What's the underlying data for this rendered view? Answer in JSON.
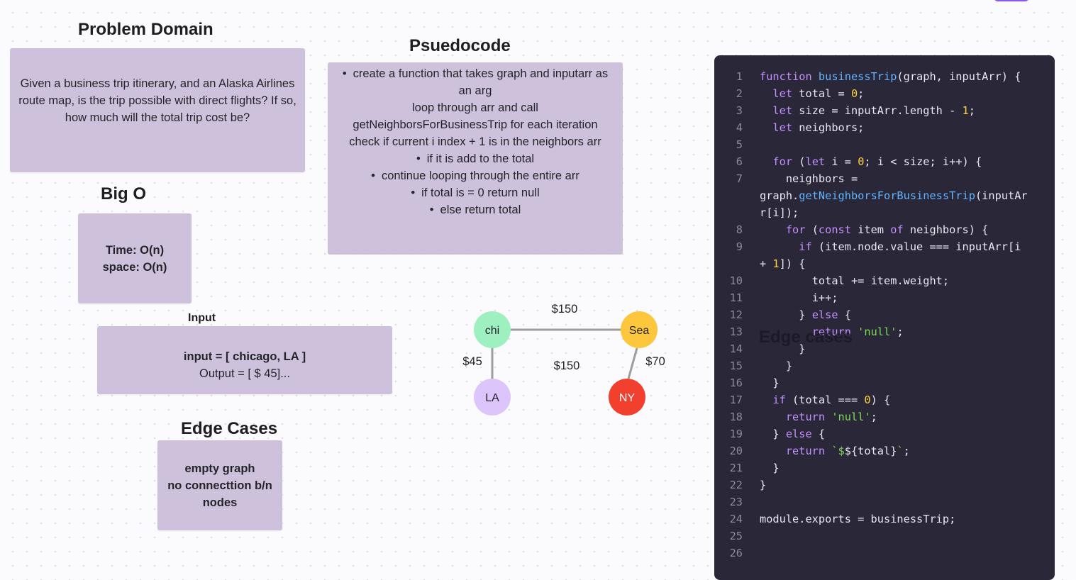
{
  "problem_domain": {
    "heading": "Problem Domain",
    "text": "Given a business trip itinerary, and an Alaska Airlines route map, is the trip possible with direct flights? If so, how much will the total trip cost be?"
  },
  "big_o": {
    "heading": "Big O",
    "time": "Time: O(n)",
    "space": "space: O(n)"
  },
  "input": {
    "heading": "Input",
    "input_line": "input = [ chicago, LA ]",
    "output_line": "Output = [ $ 45]..."
  },
  "edge_cases": {
    "heading": "Edge Cases",
    "items": [
      "empty graph",
      "no connecttion b/n",
      "nodes"
    ]
  },
  "pseudocode": {
    "heading": "Psuedocode",
    "lines": [
      {
        "text": "create a function that takes graph and inputarr as",
        "bullet": true
      },
      {
        "text": "an arg",
        "bullet": false
      },
      {
        "text": "loop through arr and call",
        "bullet": false
      },
      {
        "text": "getNeighborsForBusinessTrip for each iteration",
        "bullet": false
      },
      {
        "text": "check if current i index + 1 is in the neighbors arr",
        "bullet": false
      },
      {
        "text": "if it is add to the total",
        "bullet": true
      },
      {
        "text": "continue looping through the entire arr",
        "bullet": true
      },
      {
        "text": "if total is = 0 return null",
        "bullet": true
      },
      {
        "text": "else return total",
        "bullet": true
      }
    ]
  },
  "graph": {
    "nodes": {
      "chi": {
        "label": "chi",
        "color": "#9ef0c0"
      },
      "sea": {
        "label": "Sea",
        "color": "#fcc73c"
      },
      "la": {
        "label": "LA",
        "color": "#dcc5fb"
      },
      "ny": {
        "label": "NY",
        "color": "#f2402f",
        "text_color": "#ffffff"
      }
    },
    "edge_labels": {
      "chi_sea": "$150",
      "chi_la": "$45",
      "middle": "$150",
      "sea_ny": "$70"
    }
  },
  "code": {
    "line_numbers": [
      "1",
      "2",
      "3",
      "4",
      "5",
      "6",
      "7",
      "",
      "",
      "8",
      "9",
      "",
      "10",
      "11",
      "12",
      "13",
      "14",
      "15",
      "16",
      "17",
      "18",
      "19",
      "20",
      "21",
      "22",
      "23",
      "24",
      "25",
      "26"
    ],
    "overlay_text": "Edge cases"
  },
  "colors": {
    "sticky": "#cdc1db",
    "code_bg": "#2a2738",
    "keyword": "#c490ff",
    "function": "#62b4ff",
    "number": "#ffd23f",
    "string": "#7ed957"
  }
}
